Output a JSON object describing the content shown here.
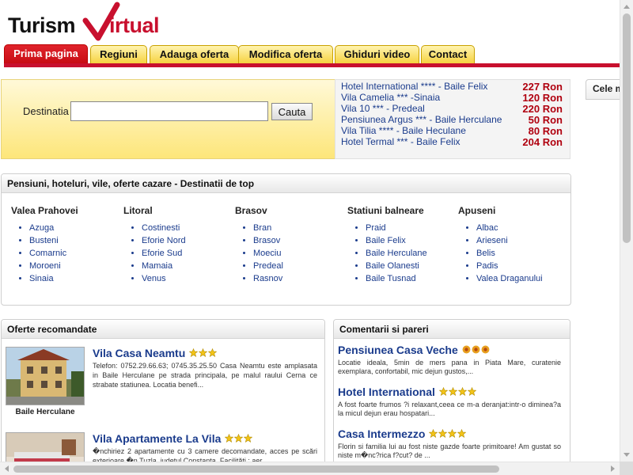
{
  "logo": {
    "part1": "Turism",
    "part2": "irtual"
  },
  "nav": {
    "tabs": [
      {
        "label": "Prima pagina",
        "active": true
      },
      {
        "label": "Regiuni"
      },
      {
        "label": "Adauga oferta"
      },
      {
        "label": "Modifica oferta"
      },
      {
        "label": "Ghiduri video"
      },
      {
        "label": "Contact"
      }
    ]
  },
  "search": {
    "label": "Destinatia",
    "value": "",
    "button": "Cauta"
  },
  "offers": [
    {
      "name": "Hotel International **** - Baile Felix",
      "price": "227 Ron"
    },
    {
      "name": "Vila Camelia *** -Sinaia",
      "price": "120 Ron"
    },
    {
      "name": "Vila 10 *** - Predeal",
      "price": "220 Ron"
    },
    {
      "name": "Pensiunea Argus *** - Baile Herculane",
      "price": "50 Ron"
    },
    {
      "name": "Vila Tilia **** - Baile Heculane",
      "price": "80 Ron"
    },
    {
      "name": "Hotel Termal *** - Baile Felix",
      "price": "204 Ron"
    }
  ],
  "right_column": {
    "title": "Cele m"
  },
  "destinations": {
    "title": "Pensiuni, hoteluri, vile, oferte cazare - Destinatii de top",
    "columns": [
      {
        "title": "Valea Prahovei",
        "items": [
          "Azuga",
          "Busteni",
          "Comarnic",
          "Moroeni",
          "Sinaia"
        ]
      },
      {
        "title": "Litoral",
        "items": [
          "Costinesti",
          "Eforie Nord",
          "Eforie Sud",
          "Mamaia",
          "Venus"
        ]
      },
      {
        "title": "Brasov",
        "items": [
          "Bran",
          "Brasov",
          "Moeciu",
          "Predeal",
          "Rasnov"
        ]
      },
      {
        "title": "Statiuni balneare",
        "items": [
          "Praid",
          "Baile Felix",
          "Baile Herculane",
          "Baile Olanesti",
          "Baile Tusnad"
        ]
      },
      {
        "title": "Apuseni",
        "items": [
          "Albac",
          "Arieseni",
          "Belis",
          "Padis",
          "Valea Draganului"
        ]
      }
    ]
  },
  "recommended": {
    "title": "Oferte recomandate",
    "items": [
      {
        "title": "Vila Casa Neamtu",
        "stars": 3,
        "caption": "Baile Herculane",
        "desc": "Telefon: 0752.29.66.63; 0745.35.25.50 Casa Neamtu este amplasata in Baile Herculane pe strada principala, pe malul raului Cerna ce strabate statiunea. Locatia benefi..."
      },
      {
        "title": "Vila Apartamente La Vila",
        "stars": 3,
        "caption": "",
        "desc": "�nchiriez 2 apartamente cu 3 camere decomandate, acces pe scări exterioare �n Tuzla, judetul Constanta. Facilităti : aer"
      }
    ]
  },
  "comments": {
    "title": "Comentarii si pareri",
    "items": [
      {
        "title": "Pensiunea Casa Veche",
        "stars": 3,
        "star_style": "flower",
        "desc": "Locatie ideala, 5min de mers pana in Piata Mare, curatenie exemplara, confortabil, mic dejun gustos,..."
      },
      {
        "title": "Hotel International",
        "stars": 4,
        "desc": "A fost foarte frumos ?i relaxant,ceea ce m-a deranjat:intr-o diminea?a la micul dejun erau hospatari..."
      },
      {
        "title": "Casa Intermezzo",
        "stars": 4,
        "desc": "Florin si familia lui au fost niste gazde foarte primitoare! Am gustat so niste m�nc?rica f?cut? de ..."
      }
    ]
  },
  "colors": {
    "brand_red": "#c8102e",
    "tab_yellow": "#f6d240",
    "link_blue": "#1a3b8c",
    "price_red": "#b0000f"
  }
}
